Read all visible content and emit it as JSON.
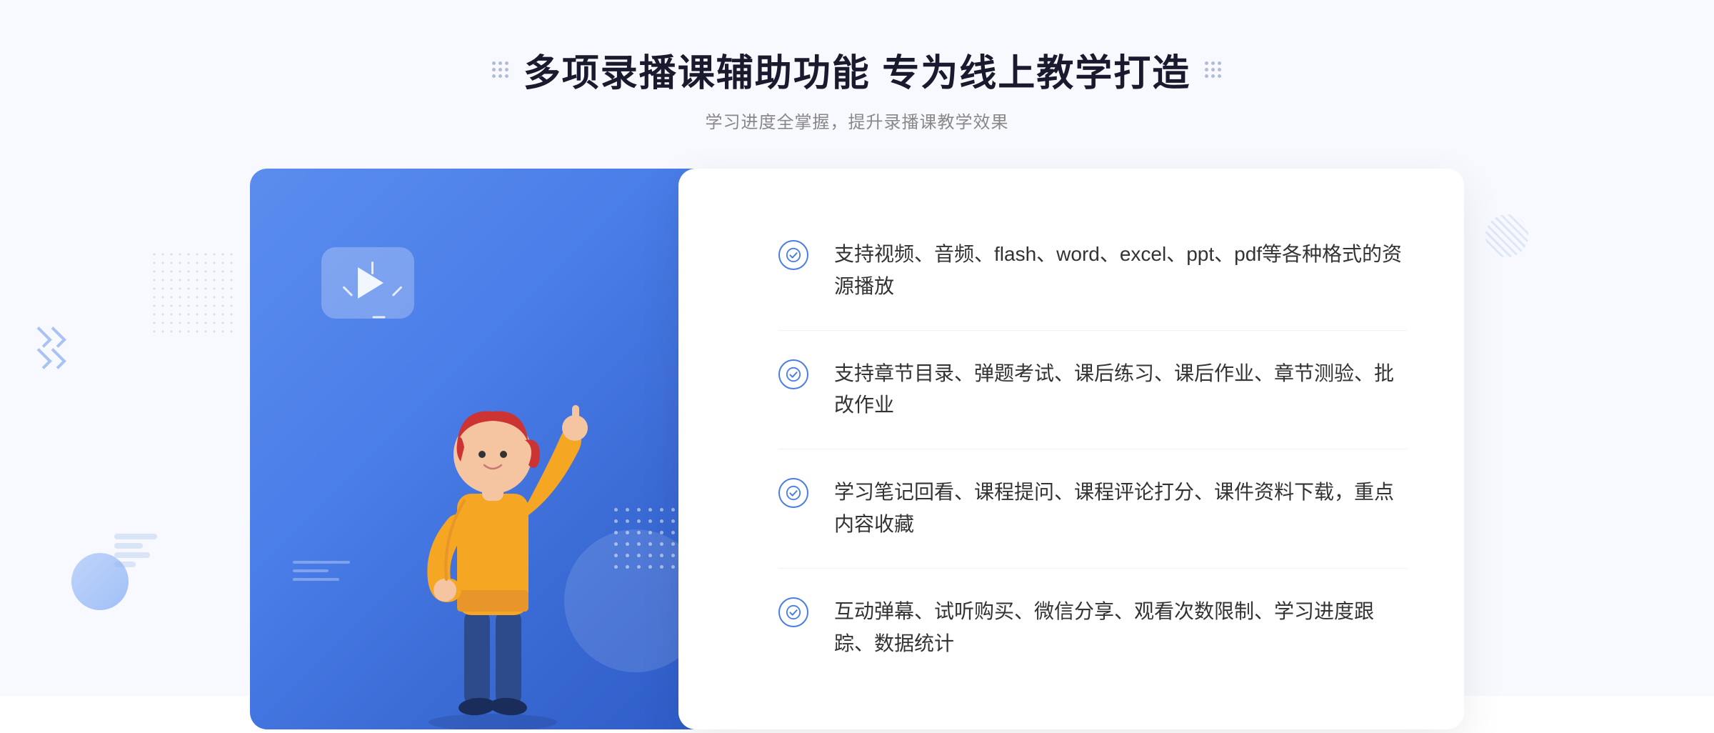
{
  "page": {
    "background_color": "#f8f9ff"
  },
  "header": {
    "main_title": "多项录播课辅助功能 专为线上教学打造",
    "sub_title": "学习进度全掌握，提升录播课教学效果"
  },
  "features": [
    {
      "id": 1,
      "text": "支持视频、音频、flash、word、excel、ppt、pdf等各种格式的资源播放"
    },
    {
      "id": 2,
      "text": "支持章节目录、弹题考试、课后练习、课后作业、章节测验、批改作业"
    },
    {
      "id": 3,
      "text": "学习笔记回看、课程提问、课程评论打分、课件资料下载，重点内容收藏"
    },
    {
      "id": 4,
      "text": "互动弹幕、试听购买、微信分享、观看次数限制、学习进度跟踪、数据统计"
    }
  ],
  "icons": {
    "check_circle": "check-circle-icon",
    "play_button": "play-button-icon",
    "chevrons": "chevrons-icon"
  }
}
